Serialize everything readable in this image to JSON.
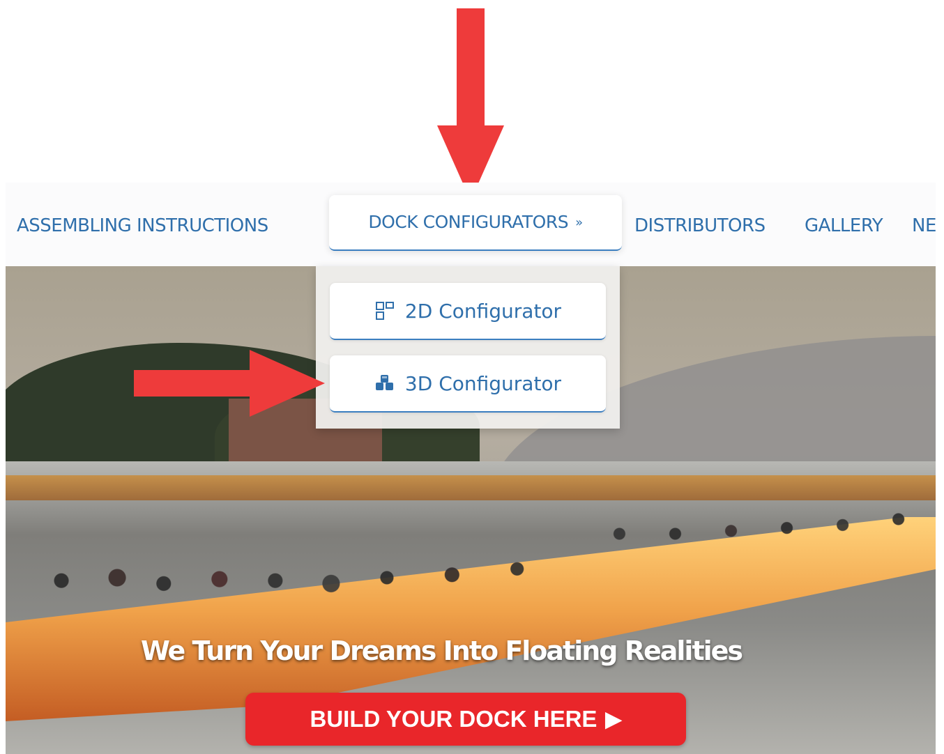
{
  "nav": {
    "items": [
      {
        "label": "ASSEMBLING INSTRUCTIONS"
      },
      {
        "label": "DOCK CONFIGURATORS",
        "chevron": "double-chevron-down-icon"
      },
      {
        "label": "DISTRIBUTORS"
      },
      {
        "label": "GALLERY"
      },
      {
        "label": "NE"
      }
    ]
  },
  "dropdown": {
    "items": [
      {
        "label": "2D Configurator",
        "icon": "grid-layout-icon"
      },
      {
        "label": "3D Configurator",
        "icon": "cubes-icon"
      }
    ]
  },
  "hero": {
    "title": "We Turn Your Dreams Into Floating Realities",
    "cta_label": "BUILD YOUR DOCK HERE",
    "cta_icon": "play-icon"
  },
  "annotations": {
    "arrow_color": "#ee3b3b",
    "arrows": [
      "arrow-down-icon",
      "arrow-right-icon"
    ]
  },
  "colors": {
    "accent": "#2f6fab",
    "cta": "#e9262a"
  }
}
